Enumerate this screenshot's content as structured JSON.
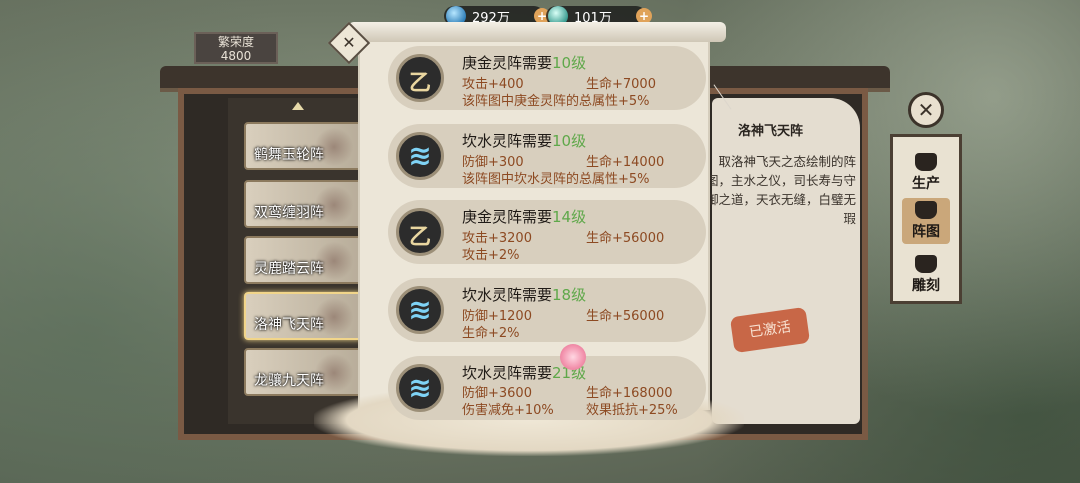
{
  "resources": [
    {
      "name": "gem",
      "icon": "gem-icon",
      "value": "292万"
    },
    {
      "name": "coin",
      "icon": "coin-icon",
      "value": "101万"
    }
  ],
  "prosperity": {
    "label": "繁荣度",
    "value": "4800"
  },
  "formations": [
    {
      "label": "鹤舞玉轮阵"
    },
    {
      "label": "双鸾缠羽阵"
    },
    {
      "label": "灵鹿踏云阵"
    },
    {
      "label": "洛神飞天阵"
    },
    {
      "label": "龙骧九天阵"
    }
  ],
  "detail": {
    "title": "洛神飞天阵",
    "description": "取洛神飞天之态绘制的阵图，主水之仪，司长寿与守御之道，天衣无缝，白璧无瑕",
    "stamp": "已激活"
  },
  "side_nav": [
    {
      "label": "生产",
      "icon": "pot-icon"
    },
    {
      "label": "阵图",
      "icon": "scroll-icon"
    },
    {
      "label": "雕刻",
      "icon": "hammer-icon"
    }
  ],
  "requirements": [
    {
      "element": "庚金灵阵需要",
      "level": "10级",
      "emblem": "metal-emblem-icon",
      "stats": [
        "攻击+400",
        "生命+7000",
        "该阵图中庚金灵阵的总属性+5%"
      ]
    },
    {
      "element": "坎水灵阵需要",
      "level": "10级",
      "emblem": "water-emblem-icon",
      "stats": [
        "防御+300",
        "生命+14000",
        "该阵图中坎水灵阵的总属性+5%"
      ]
    },
    {
      "element": "庚金灵阵需要",
      "level": "14级",
      "emblem": "metal-emblem-icon",
      "stats": [
        "攻击+3200",
        "生命+56000",
        "攻击+2%"
      ]
    },
    {
      "element": "坎水灵阵需要",
      "level": "18级",
      "emblem": "water-emblem-icon",
      "stats": [
        "防御+1200",
        "生命+56000",
        "生命+2%"
      ]
    },
    {
      "element": "坎水灵阵需要",
      "level": "21级",
      "emblem": "water-emblem-icon",
      "stats": [
        "防御+3600",
        "生命+168000",
        "伤害减免+10%",
        "效果抵抗+25%"
      ]
    }
  ]
}
